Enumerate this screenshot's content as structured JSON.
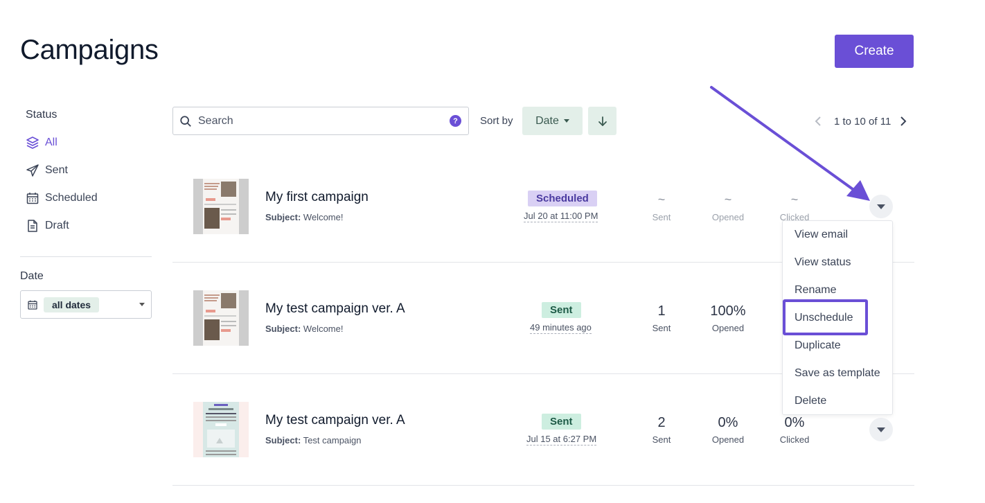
{
  "page": {
    "title": "Campaigns",
    "create_label": "Create"
  },
  "sidebar": {
    "status_heading": "Status",
    "items": [
      {
        "label": "All",
        "icon": "layers-icon",
        "active": true
      },
      {
        "label": "Sent",
        "icon": "paper-plane-icon",
        "active": false
      },
      {
        "label": "Scheduled",
        "icon": "calendar-icon",
        "active": false
      },
      {
        "label": "Draft",
        "icon": "document-icon",
        "active": false
      }
    ],
    "date_heading": "Date",
    "date_filter": "all dates"
  },
  "toolbar": {
    "search_placeholder": "Search",
    "help": "?",
    "sort_label": "Sort by",
    "sort_value": "Date",
    "pager_text": "1 to 10 of 11"
  },
  "campaigns": [
    {
      "name": "My first campaign",
      "subject_label": "Subject:",
      "subject": "Welcome!",
      "status": "Scheduled",
      "when": "Jul 20 at 11:00 PM",
      "sent": "~",
      "sent_label": "Sent",
      "opened": "~",
      "opened_label": "Opened",
      "clicked": "~",
      "clicked_label": "Clicked"
    },
    {
      "name": "My test campaign ver. A",
      "subject_label": "Subject:",
      "subject": "Welcome!",
      "status": "Sent",
      "when": "49 minutes ago",
      "sent": "1",
      "sent_label": "Sent",
      "opened": "100%",
      "opened_label": "Opened"
    },
    {
      "name": "My test campaign ver. A",
      "subject_label": "Subject:",
      "subject": "Test campaign",
      "status": "Sent",
      "when": "Jul 15 at 6:27 PM",
      "sent": "2",
      "sent_label": "Sent",
      "opened": "0%",
      "opened_label": "Opened",
      "clicked": "0%",
      "clicked_label": "Clicked"
    }
  ],
  "row_menu": {
    "items": [
      "View email",
      "View status",
      "Rename",
      "Unschedule",
      "Duplicate",
      "Save as template",
      "Delete"
    ],
    "highlighted": "Unschedule"
  },
  "colors": {
    "accent": "#6a4fd6",
    "mint": "#e3efe9",
    "scheduled_badge": "#d9d0f4",
    "sent_badge": "#cdeee0"
  }
}
